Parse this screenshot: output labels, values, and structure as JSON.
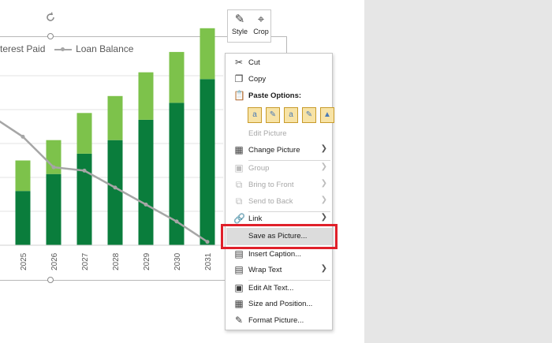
{
  "legend": {
    "item1": "terest Paid",
    "item2": "Loan Balance"
  },
  "colors": {
    "bar_dark": "#0a7d3c",
    "bar_light": "#7dc24b",
    "line": "#a6a6a6",
    "highlight_box": "#e0202a"
  },
  "chart_data": {
    "type": "bar",
    "categories": [
      "2025",
      "2026",
      "2027",
      "2028",
      "2029",
      "2030",
      "2031"
    ],
    "series": [
      {
        "name": "",
        "values": [
          16,
          21,
          27,
          31,
          37,
          42,
          49
        ]
      },
      {
        "name": "",
        "values": [
          9,
          10,
          12,
          13,
          14,
          15,
          15
        ]
      },
      {
        "name": "Loan Balance",
        "values": [
          32,
          23,
          22,
          17,
          12,
          7,
          1
        ]
      }
    ],
    "ylim": [
      0,
      60
    ]
  },
  "floatie": {
    "style_label": "Style",
    "crop_label": "Crop"
  },
  "menu": {
    "cut": "Cut",
    "copy": "Copy",
    "paste_options": "Paste Options:",
    "edit_picture": "Edit Picture",
    "change_picture": "Change Picture",
    "group": "Group",
    "bring_to_front": "Bring to Front",
    "send_to_back": "Send to Back",
    "link": "Link",
    "save_as_picture": "Save as Picture...",
    "insert_caption": "Insert Caption...",
    "wrap_text": "Wrap Text",
    "edit_alt_text": "Edit Alt Text...",
    "size_and_position": "Size and Position...",
    "format_picture": "Format Picture..."
  }
}
